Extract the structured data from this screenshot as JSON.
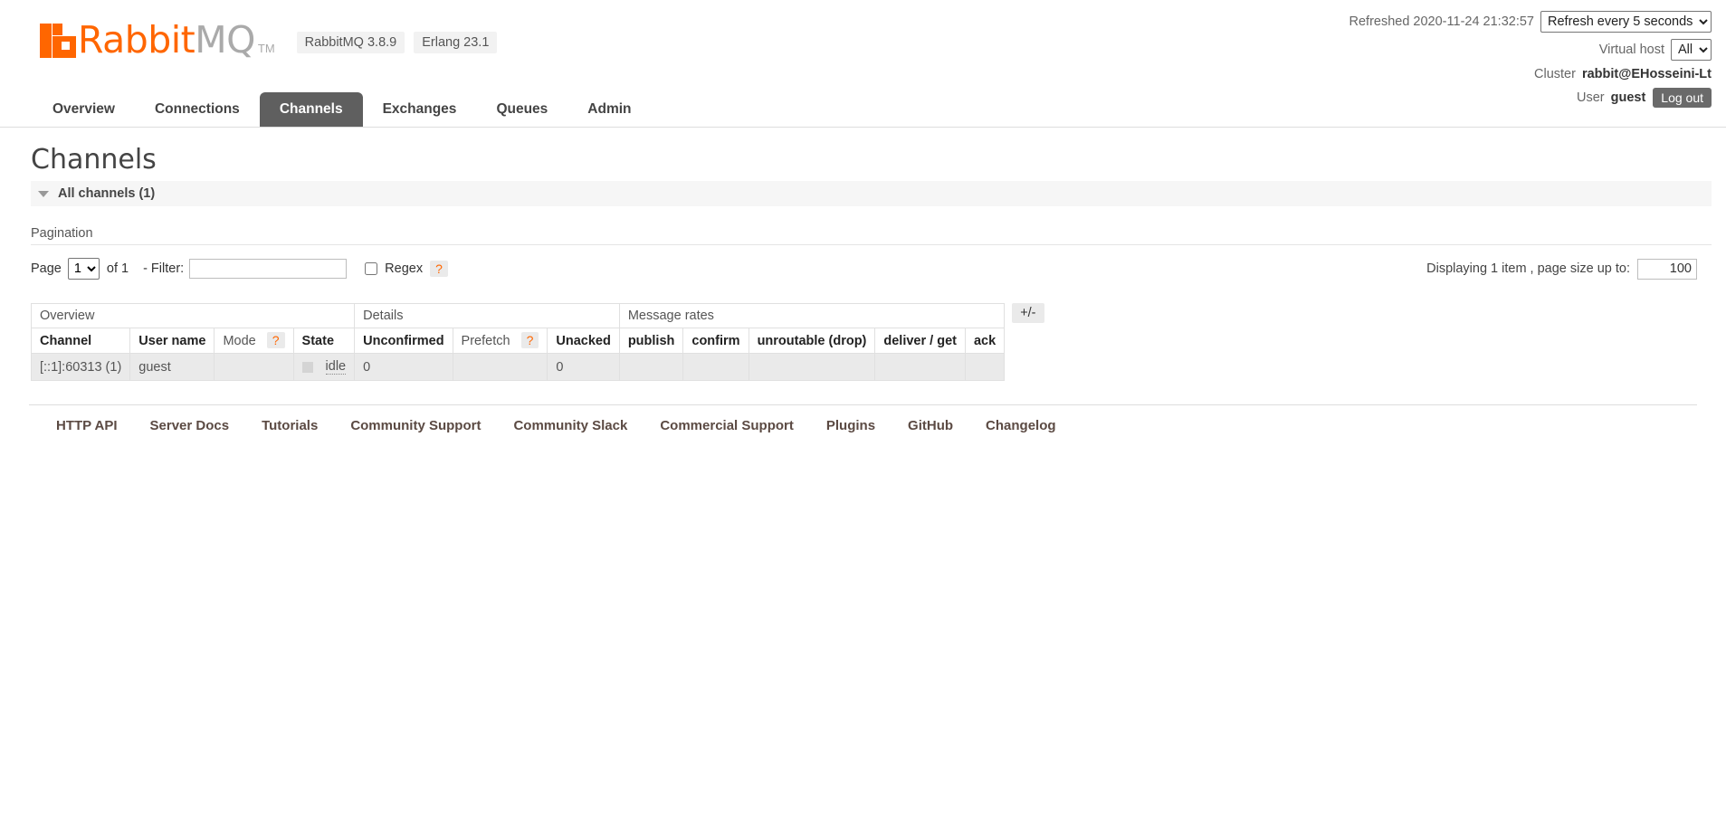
{
  "header": {
    "logo": {
      "rabbit": "Rabbit",
      "mq": "MQ",
      "tm": "TM"
    },
    "version_badges": [
      "RabbitMQ 3.8.9",
      "Erlang 23.1"
    ],
    "refreshed_label": "Refreshed 2020-11-24 21:32:57",
    "refresh_select": "Refresh every 5 seconds",
    "vhost_label": "Virtual host",
    "vhost_select": "All",
    "cluster_label": "Cluster",
    "cluster_name": "rabbit@EHosseini-Lt",
    "user_label": "User",
    "user_name": "guest",
    "logout_label": "Log out"
  },
  "nav": {
    "tabs": [
      {
        "label": "Overview",
        "active": false
      },
      {
        "label": "Connections",
        "active": false
      },
      {
        "label": "Channels",
        "active": true
      },
      {
        "label": "Exchanges",
        "active": false
      },
      {
        "label": "Queues",
        "active": false
      },
      {
        "label": "Admin",
        "active": false
      }
    ]
  },
  "page": {
    "title": "Channels",
    "section_label": "All channels (1)",
    "pagination_label": "Pagination"
  },
  "pagination": {
    "page_label": "Page",
    "page_value": "1",
    "of_label": "of 1",
    "filter_label": "- Filter:",
    "filter_value": "",
    "filter_placeholder": "",
    "regex_label": "Regex",
    "regex_help": "?",
    "regex_checked": false,
    "display_info": "Displaying 1 item , page size up to:",
    "page_size_value": "100"
  },
  "table": {
    "groups": [
      {
        "label": "Overview",
        "span": 4
      },
      {
        "label": "Details",
        "span": 3
      },
      {
        "label": "Message rates",
        "span": 5
      }
    ],
    "columns": [
      {
        "label": "Channel",
        "bold": true,
        "align": "left"
      },
      {
        "label": "User name",
        "bold": true,
        "align": "center"
      },
      {
        "label": "Mode",
        "bold": false,
        "align": "left",
        "help": "?"
      },
      {
        "label": "State",
        "bold": true,
        "align": "left"
      },
      {
        "label": "Unconfirmed",
        "bold": true,
        "align": "center"
      },
      {
        "label": "Prefetch",
        "bold": false,
        "align": "left",
        "help": "?"
      },
      {
        "label": "Unacked",
        "bold": true,
        "align": "center"
      },
      {
        "label": "publish",
        "bold": true,
        "align": "left"
      },
      {
        "label": "confirm",
        "bold": true,
        "align": "left"
      },
      {
        "label": "unroutable (drop)",
        "bold": true,
        "align": "left"
      },
      {
        "label": "deliver / get",
        "bold": true,
        "align": "left"
      },
      {
        "label": "ack",
        "bold": true,
        "align": "left"
      }
    ],
    "rows": [
      {
        "channel": "[::1]:60313 (1)",
        "user_name": "guest",
        "mode": "",
        "state": "idle",
        "unconfirmed": "0",
        "prefetch": "",
        "unacked": "0",
        "publish": "",
        "confirm": "",
        "unroutable": "",
        "deliver_get": "",
        "ack": ""
      }
    ],
    "toggle_columns_label": "+/-"
  },
  "footer": {
    "links": [
      "HTTP API",
      "Server Docs",
      "Tutorials",
      "Community Support",
      "Community Slack",
      "Commercial Support",
      "Plugins",
      "GitHub",
      "Changelog"
    ]
  },
  "colors": {
    "brand_orange": "#ff6600",
    "active_tab": "#5f5f5f",
    "row_bg": "#eaeaea"
  }
}
